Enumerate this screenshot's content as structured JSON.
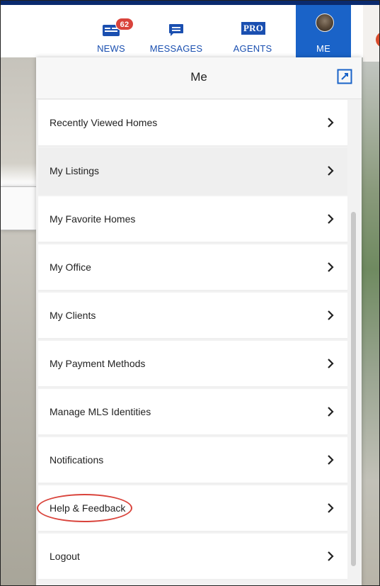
{
  "topnav": {
    "news": {
      "label": "NEWS",
      "badge": "62"
    },
    "messages": {
      "label": "MESSAGES"
    },
    "agents": {
      "label": "AGENTS",
      "logo_text": "PRO"
    },
    "me": {
      "label": "ME"
    }
  },
  "panel": {
    "title": "Me",
    "items": [
      {
        "label": "Recently Viewed Homes",
        "active": false
      },
      {
        "label": "My Listings",
        "active": true
      },
      {
        "label": "My Favorite Homes",
        "active": false
      },
      {
        "label": "My Office",
        "active": false
      },
      {
        "label": "My Clients",
        "active": false
      },
      {
        "label": "My Payment Methods",
        "active": false
      },
      {
        "label": "Manage MLS Identities",
        "active": false
      },
      {
        "label": "Notifications",
        "active": false,
        "highlighted": true
      },
      {
        "label": "Help & Feedback",
        "active": false
      },
      {
        "label": "Logout",
        "active": false
      }
    ]
  },
  "colors": {
    "brand_blue": "#1a63c8",
    "nav_text": "#1a4fb0",
    "badge_red": "#d9433b",
    "highlight_red": "#d9433b"
  }
}
